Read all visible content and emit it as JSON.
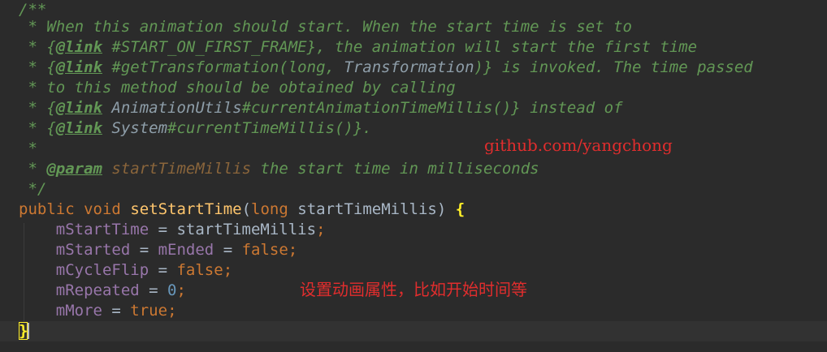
{
  "code": {
    "doc": {
      "open": "/**",
      "line1": " * When this animation should start. When the start time is set to",
      "line2_star": " * {",
      "link_tag": "@link",
      "line2_ref": " #START_ON_FIRST_FRAME",
      "line2_rest": "}, the animation will start the first time",
      "line3_a": " #getTransformation(long, ",
      "line3_ref": "Transformation",
      "line3_rest": ")} is invoked. The time passed",
      "line4": " * to this method should be obtained by calling",
      "line5_ref": " AnimationUtils",
      "line5_method": "#currentAnimationTimeMillis()",
      "line5_rest": "} instead of",
      "line6_ref": " System",
      "line6_method": "#currentTimeMillis()",
      "line6_rest": "}.",
      "blank": " *",
      "param_star": " * ",
      "param_tag": "@param",
      "param_name": "startTimeMillis",
      "param_desc": " the start time in milliseconds",
      "close": " */"
    },
    "signature": {
      "kw_public": "public",
      "kw_void": "void",
      "method": "setStartTime",
      "open_paren": "(",
      "kw_long": "long",
      "arg": " startTimeMillis) ",
      "open_brace": "{"
    },
    "body": {
      "l1_field": "mStartTime",
      "l1_rest": " = startTimeMillis",
      "l2_field_a": "mStarted",
      "eq": " = ",
      "l2_field_b": "mEnded",
      "false_kw": "false",
      "l3_field": "mCycleFlip",
      "l4_field": "mRepeated",
      "zero": "0",
      "l5_field": "mMore",
      "true_kw": "true",
      "semi": ";",
      "close_brace": "}"
    }
  },
  "overlays": {
    "watermark": "github.com/yangchong",
    "note": "设置动画属性，比如开始时间等"
  },
  "colors": {
    "background": "#2b2b2b",
    "doc_comment": "#629755",
    "keyword": "#cc7832",
    "method_name": "#ffc66d",
    "field": "#9876aa",
    "number": "#6897bb",
    "overlay_text": "#e12d2d"
  }
}
